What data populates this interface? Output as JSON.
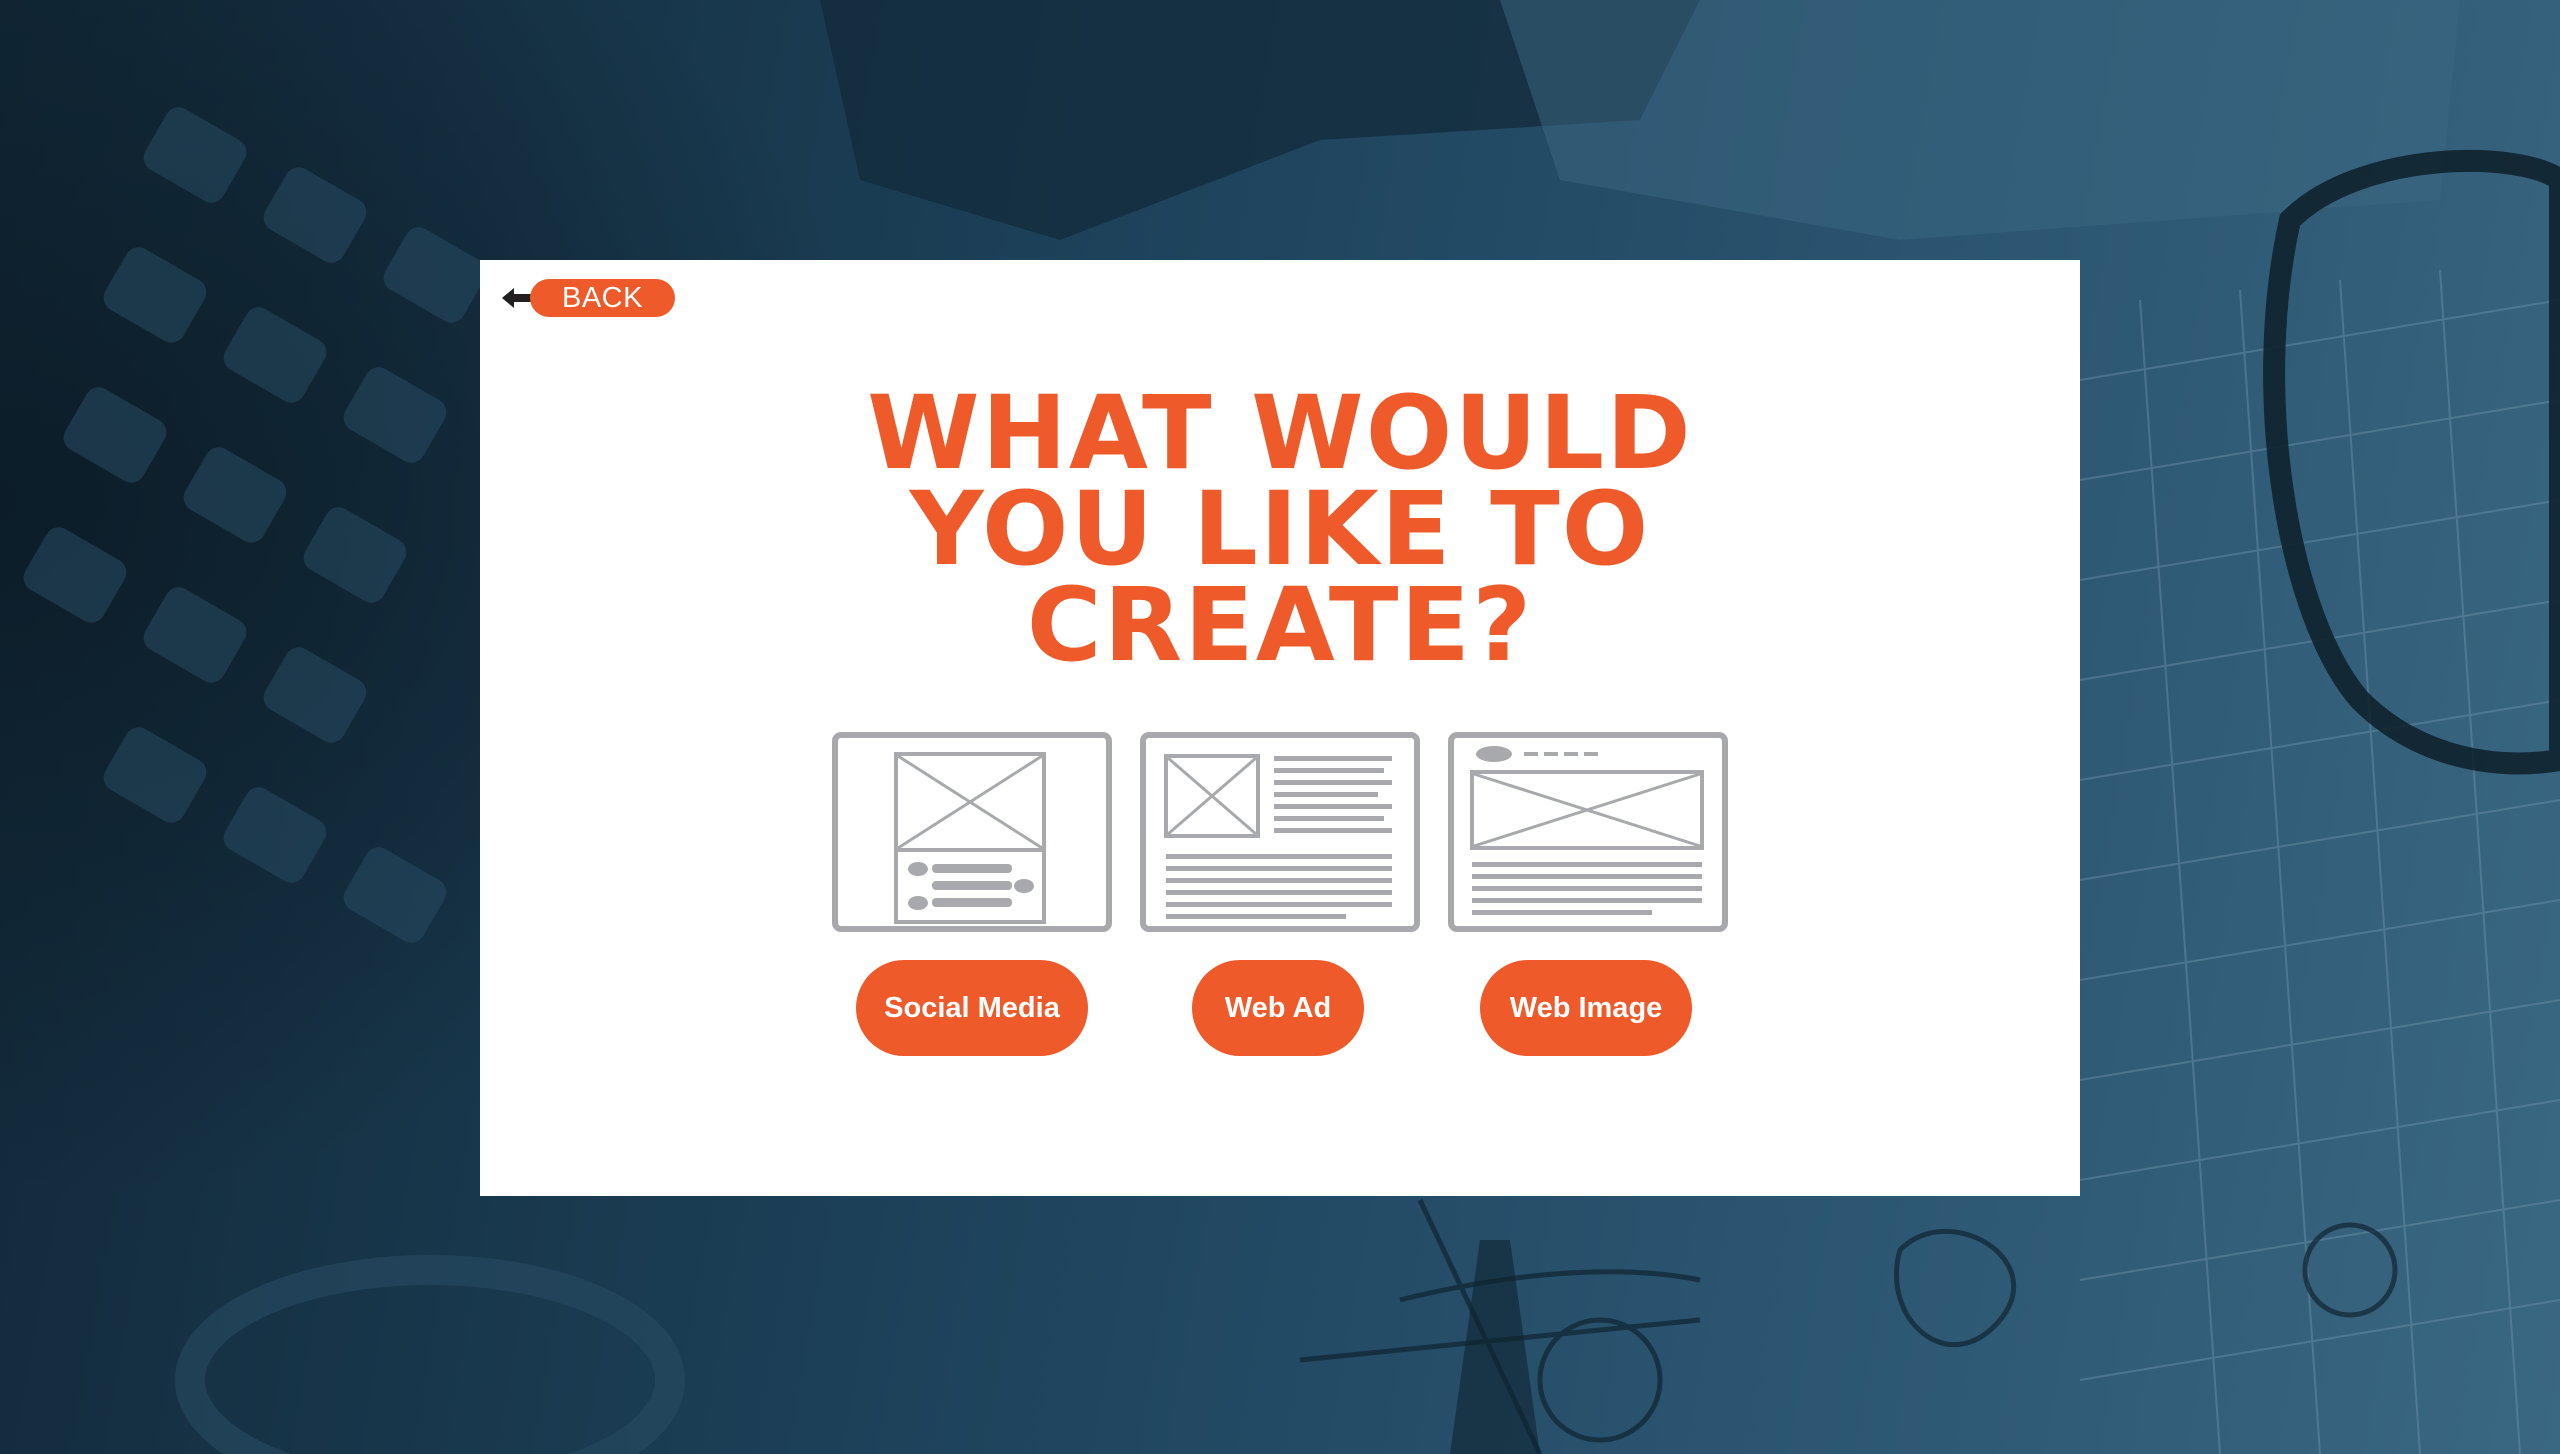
{
  "header": {
    "back_label": "BACK"
  },
  "headline": {
    "line1": "WHAT WOULD",
    "line2": "YOU LIKE TO",
    "line3": "CREATE?"
  },
  "options": [
    {
      "label": "Social Media",
      "icon": "social-media-wireframe-icon"
    },
    {
      "label": "Web Ad",
      "icon": "web-ad-wireframe-icon"
    },
    {
      "label": "Web Image",
      "icon": "web-image-wireframe-icon"
    }
  ],
  "colors": {
    "accent": "#ef5a2a",
    "wireframe": "#a7a9ac",
    "background": "#1b3a4e",
    "panel": "#ffffff"
  }
}
